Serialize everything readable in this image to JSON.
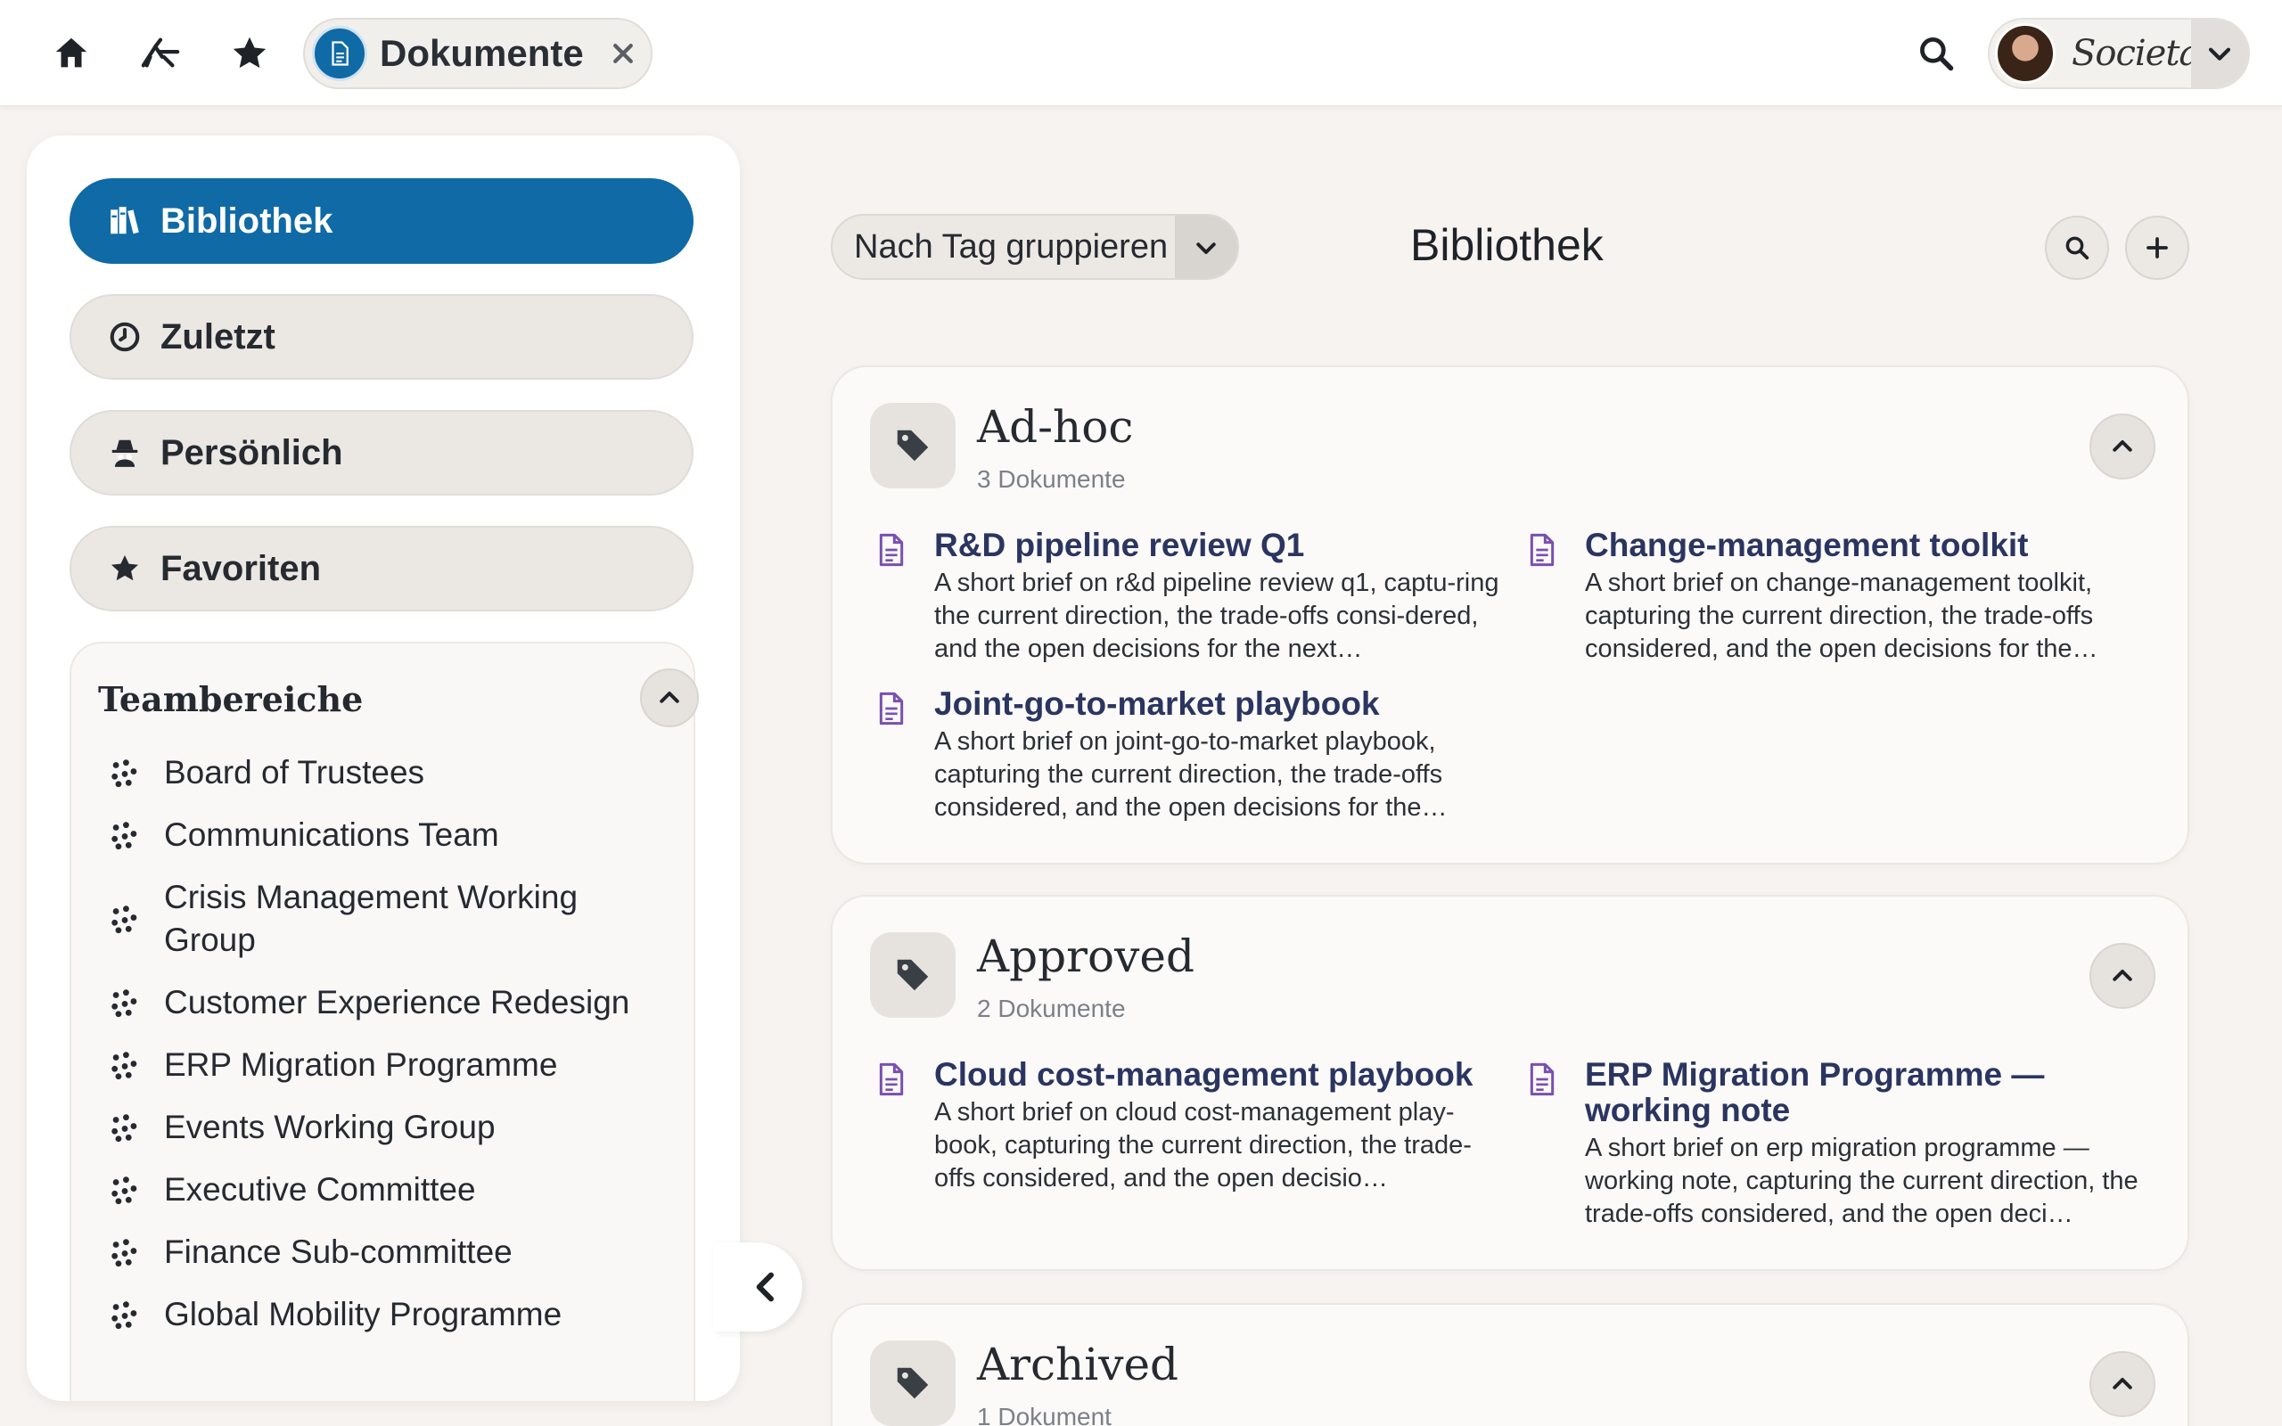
{
  "topbar": {
    "tab_label": "Dokumente",
    "org_name": "Societas",
    "icons": [
      "home-icon",
      "logo-icon",
      "star-icon",
      "document-icon",
      "close-icon",
      "search-icon",
      "chevron-down-icon"
    ]
  },
  "sidebar": {
    "nav": [
      {
        "label": "Bibliothek",
        "icon": "books-icon",
        "active": true
      },
      {
        "label": "Zuletzt",
        "icon": "clock-icon",
        "active": false
      },
      {
        "label": "Persönlich",
        "icon": "incognito-icon",
        "active": false
      },
      {
        "label": "Favoriten",
        "icon": "star-icon",
        "active": false
      }
    ],
    "teams_title": "Teambereiche",
    "teams": [
      "Board of Trustees",
      "Communications Team",
      "Crisis Management Working Group",
      "Customer Experience Redesign",
      "ERP Migration Programme",
      "Events Working Group",
      "Executive Committee",
      "Finance Sub-committee",
      "Global Mobility Programme"
    ]
  },
  "main": {
    "group_by_label": "Nach Tag gruppieren",
    "title": "Bibliothek",
    "groups": [
      {
        "name": "Ad-hoc",
        "count": "3 Dokumente",
        "docs": [
          {
            "title": "R&D pipeline review Q1",
            "desc": "A short brief on r&d pipeline review q1, captu-ring the current direction, the trade-offs consi-dered, and the open decisions for the next…"
          },
          {
            "title": "Change-management toolkit",
            "desc": "A short brief on change-management toolkit, capturing the current direction, the trade-offs considered, and the open decisions for the…"
          },
          {
            "title": "Joint-go-to-market playbook",
            "desc": "A short brief on joint-go-to-market playbook, capturing the current direction, the trade-offs considered, and the open decisions for the…"
          }
        ]
      },
      {
        "name": "Approved",
        "count": "2 Dokumente",
        "docs": [
          {
            "title": "Cloud cost-management playbook",
            "desc": "A short brief on cloud cost-management play-book, capturing the current direction, the trade-offs considered, and the open decisio…"
          },
          {
            "title": "ERP Migration Programme — working note",
            "desc": "A short brief on erp migration programme — working note, capturing the current direction, the trade-offs considered, and the open deci…"
          }
        ]
      },
      {
        "name": "Archived",
        "count": "1 Dokument",
        "docs": []
      }
    ]
  },
  "colors": {
    "primary": "#0f6aa6",
    "doc_icon": "#7a4fb0",
    "doc_title": "#2a3560",
    "background": "#f6f3f0"
  }
}
